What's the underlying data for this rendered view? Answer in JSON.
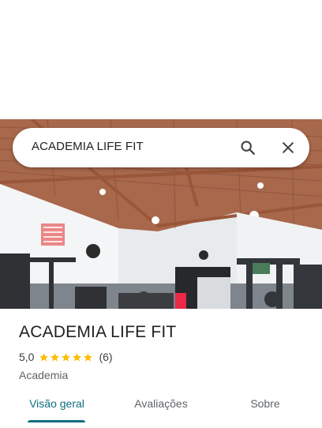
{
  "search": {
    "query": "ACADEMIA LIFE FIT"
  },
  "place": {
    "title": "ACADEMIA LIFE FIT",
    "rating": "5,0",
    "rating_stars": 5,
    "review_count": "(6)",
    "category": "Academia"
  },
  "tabs": [
    {
      "label": "Visão geral",
      "active": true
    },
    {
      "label": "Avaliações",
      "active": false
    },
    {
      "label": "Sobre",
      "active": false
    }
  ],
  "icons": {
    "search": "search-icon",
    "close": "close-icon",
    "star": "star-icon"
  },
  "colors": {
    "accent": "#0b6e7b",
    "star": "#fbbc04",
    "text_primary": "#202124",
    "text_secondary": "#5f6368"
  }
}
